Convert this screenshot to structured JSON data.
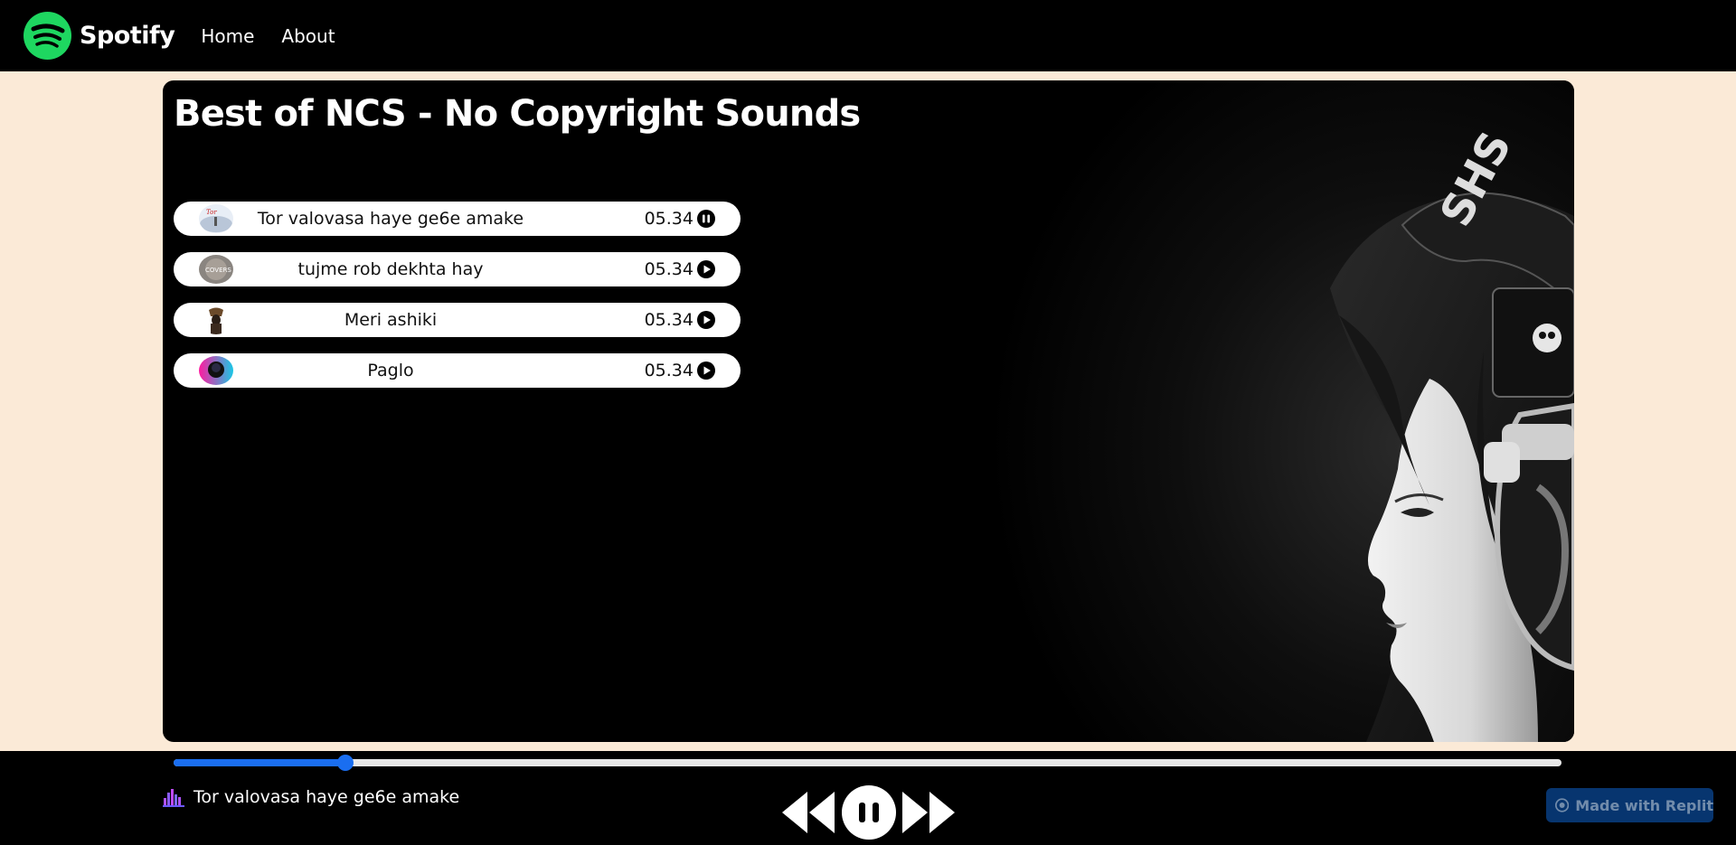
{
  "nav": {
    "brand": "Spotify",
    "links": [
      "Home",
      "About"
    ],
    "accent": "#1ed760"
  },
  "playlist": {
    "title": "Best of NCS - No Copyright Sounds",
    "songs": [
      {
        "name": "Tor valovasa haye ge6e amake",
        "duration": "05.34",
        "state": "pause-icon"
      },
      {
        "name": "tujme rob dekhta hay",
        "duration": "05.34",
        "state": "play-icon"
      },
      {
        "name": "Meri ashiki",
        "duration": "05.34",
        "state": "play-icon"
      },
      {
        "name": "Paglo",
        "duration": "05.34",
        "state": "play-icon"
      }
    ]
  },
  "player": {
    "now_playing": "Tor valovasa haye ge6e amake",
    "progress_percent": 12.4,
    "progress_color": "#1a6ef0",
    "controls": [
      "previous-icon",
      "pause-icon",
      "next-icon"
    ]
  },
  "badge": {
    "label": "Made with Replit"
  }
}
